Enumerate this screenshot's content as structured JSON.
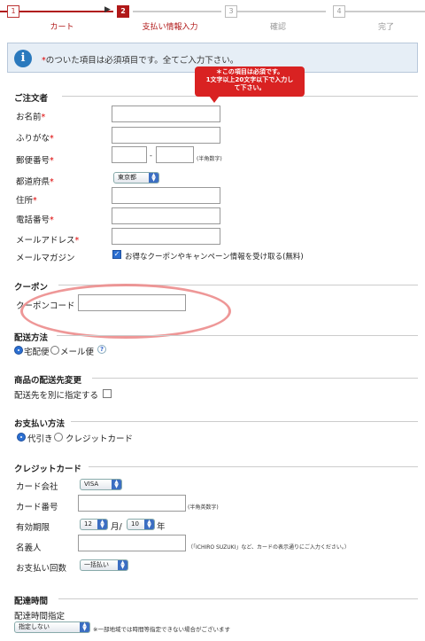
{
  "steps": [
    {
      "num": "1",
      "label": "カート"
    },
    {
      "num": "2",
      "label": "支払い情報入力"
    },
    {
      "num": "3",
      "label": "確認"
    },
    {
      "num": "4",
      "label": "完了"
    }
  ],
  "info": {
    "icon": "i",
    "required_mark": "*",
    "text": "のついた項目は必須項目です。全てご入力下さい。"
  },
  "tooltip": {
    "line1": "＊この項目は必須です。",
    "line2": "1文字以上20文字以下で入力し",
    "line3": "て下さい。"
  },
  "customer": {
    "title": "ご注文者",
    "name_label": "お名前",
    "kana_label": "ふりがな",
    "zip_label": "郵便番号",
    "zip_sep": "-",
    "zip_hint": "(半角数字)",
    "pref_label": "都道府県",
    "pref_value": "東京都",
    "address_label": "住所",
    "phone_label": "電話番号",
    "email_label": "メールアドレス",
    "magazine_label": "メールマガジン",
    "magazine_text": "お得なクーポンやキャンペーン情報を受け取る(無料)",
    "req": "*"
  },
  "coupon": {
    "title": "クーポン",
    "code_label": "クーポンコード"
  },
  "shipping": {
    "title": "配送方法",
    "opt1": "宅配便",
    "opt2": "メール便",
    "help": "?"
  },
  "delivery_dest": {
    "title": "商品の配送先変更",
    "label": "配送先を別に指定する"
  },
  "payment": {
    "title": "お支払い方法",
    "opt1": "代引き",
    "opt2": "クレジットカード"
  },
  "credit": {
    "title": "クレジットカード",
    "company_label": "カード会社",
    "company_value": "VISA",
    "number_label": "カード番号",
    "number_hint": "(半角英数字)",
    "expiry_label": "有効期限",
    "month_value": "12",
    "month_unit": "月/",
    "year_value": "10",
    "year_unit": "年",
    "holder_label": "名義人",
    "holder_hint": "（「ICHIRO SUZUKI」など、カードの表示通りにご入力ください。）",
    "installment_label": "お支払い回数",
    "installment_value": "一括払い"
  },
  "delivery_time": {
    "title": "配達時間",
    "label": "配達時間指定",
    "value": "指定しない",
    "note": "※一部地域では時間等指定できない場合がございます"
  },
  "colors": {
    "accent": "#b01818",
    "info_bg": "#e6eef6",
    "tooltip": "#d92222",
    "highlight": "#ec8c8c"
  }
}
